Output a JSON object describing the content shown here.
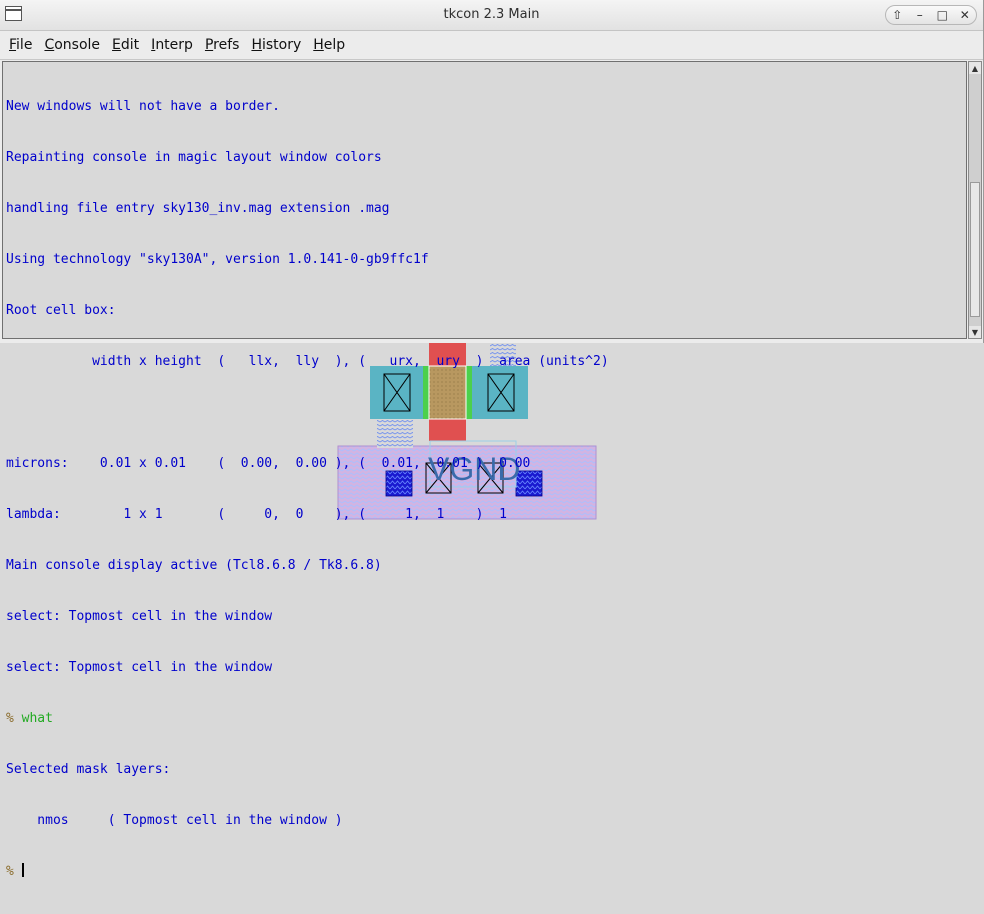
{
  "window": {
    "title": "tkcon 2.3 Main"
  },
  "title_buttons": {
    "up": "⇧",
    "min": "–",
    "max": "□",
    "close": "✕"
  },
  "menubar": [
    {
      "label_u": "F",
      "label_rest": "ile"
    },
    {
      "label_u": "C",
      "label_rest": "onsole"
    },
    {
      "label_u": "E",
      "label_rest": "dit"
    },
    {
      "label_u": "I",
      "label_rest": "nterp"
    },
    {
      "label_u": "P",
      "label_rest": "refs"
    },
    {
      "label_u": "H",
      "label_rest": "istory"
    },
    {
      "label_u": "H",
      "label_rest": "elp"
    }
  ],
  "console": {
    "lines": [
      "New windows will not have a border.",
      "Repainting console in magic layout window colors",
      "handling file entry sky130_inv.mag extension .mag",
      "Using technology \"sky130A\", version 1.0.141-0-gb9ffc1f",
      "Root cell box:",
      "           width x height  (   llx,  lly  ), (   urx,  ury  )  area (units^2)",
      "",
      "microns:    0.01 x 0.01    (  0.00,  0.00 ), (  0.01,  0.01 )  0.00",
      "lambda:        1 x 1       (     0,  0    ), (     1,  1    )  1",
      "Main console display active (Tcl8.6.8 / Tk8.6.8)",
      "select: Topmost cell in the window",
      "select: Topmost cell in the window"
    ],
    "prompt": "%",
    "command": "what",
    "output_lines": [
      "Selected mask layers:",
      "    nmos     ( Topmost cell in the window )"
    ]
  },
  "layout": {
    "label": "VGND"
  },
  "colors": {
    "console_text": "#0000cc",
    "command_text": "#22aa22",
    "poly": "#e05050",
    "diffusion": "#5ab4c4",
    "pwell": "#c8a0e0"
  }
}
